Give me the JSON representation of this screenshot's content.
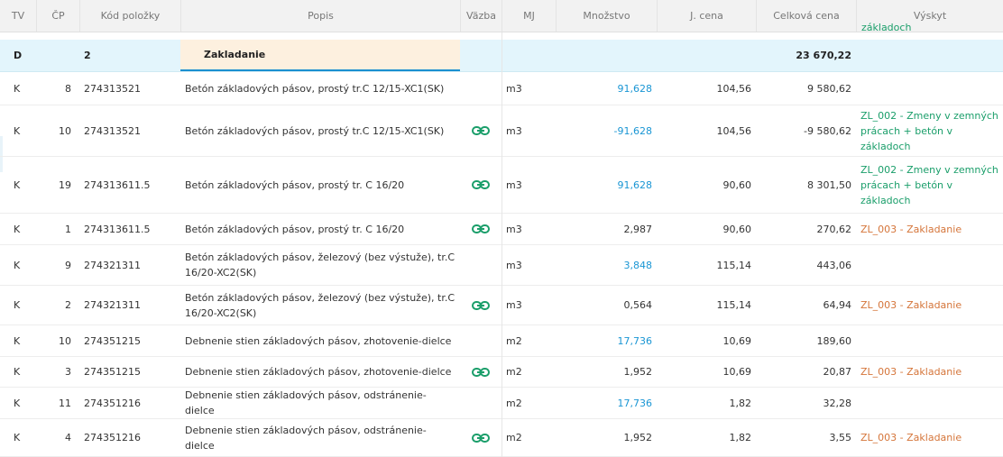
{
  "header": {
    "tv": "TV",
    "cp": "ČP",
    "kod": "Kód položky",
    "popis": "Popis",
    "vazba": "Väzba",
    "mj": "MJ",
    "mnozstvo": "Množstvo",
    "jcena": "J. cena",
    "celkova": "Celková cena",
    "vyskyt": "Výskyt",
    "spill": "základoch"
  },
  "group": {
    "tv": "D",
    "cp": "2",
    "popis": "Zakladanie",
    "celkova": "23 670,22"
  },
  "rows": [
    {
      "tv": "K",
      "cp": "8",
      "kod": "274313521",
      "popis": "Betón základových pásov, prostý tr.C 12/15-XC1(SK)",
      "link": false,
      "mj": "m3",
      "mnozstvo": "91,628",
      "mn_color": "blue",
      "jcena": "104,56",
      "celkova": "9 580,62",
      "vyskyt": "",
      "vy_color": ""
    },
    {
      "tv": "K",
      "cp": "10",
      "kod": "274313521",
      "popis": "Betón základových pásov, prostý tr.C 12/15-XC1(SK)",
      "link": true,
      "mj": "m3",
      "mnozstvo": "-91,628",
      "mn_color": "blue",
      "jcena": "104,56",
      "celkova": "-9 580,62",
      "vyskyt": "ZL_002 - Zmeny v zemných prácach + betón v základoch",
      "vy_color": "green"
    },
    {
      "tv": "K",
      "cp": "19",
      "kod": "274313611.5",
      "popis": "Betón základových pásov, prostý tr. C 16/20",
      "link": true,
      "mj": "m3",
      "mnozstvo": "91,628",
      "mn_color": "blue",
      "jcena": "90,60",
      "celkova": "8 301,50",
      "vyskyt": "ZL_002 - Zmeny v zemných prácach + betón v základoch",
      "vy_color": "green"
    },
    {
      "tv": "K",
      "cp": "1",
      "kod": "274313611.5",
      "popis": "Betón základových pásov, prostý tr. C 16/20",
      "link": true,
      "mj": "m3",
      "mnozstvo": "2,987",
      "mn_color": "",
      "jcena": "90,60",
      "celkova": "270,62",
      "vyskyt": "ZL_003 - Zakladanie",
      "vy_color": "orange"
    },
    {
      "tv": "K",
      "cp": "9",
      "kod": "274321311",
      "popis": "Betón základových pásov, železový (bez výstuže), tr.C 16/20-XC2(SK)",
      "link": false,
      "mj": "m3",
      "mnozstvo": "3,848",
      "mn_color": "blue",
      "jcena": "115,14",
      "celkova": "443,06",
      "vyskyt": "",
      "vy_color": ""
    },
    {
      "tv": "K",
      "cp": "2",
      "kod": "274321311",
      "popis": "Betón základových pásov, železový (bez výstuže), tr.C 16/20-XC2(SK)",
      "link": true,
      "mj": "m3",
      "mnozstvo": "0,564",
      "mn_color": "",
      "jcena": "115,14",
      "celkova": "64,94",
      "vyskyt": "ZL_003 - Zakladanie",
      "vy_color": "orange"
    },
    {
      "tv": "K",
      "cp": "10",
      "kod": "274351215",
      "popis": "Debnenie stien základových pásov, zhotovenie-dielce",
      "link": false,
      "mj": "m2",
      "mnozstvo": "17,736",
      "mn_color": "blue",
      "jcena": "10,69",
      "celkova": "189,60",
      "vyskyt": "",
      "vy_color": ""
    },
    {
      "tv": "K",
      "cp": "3",
      "kod": "274351215",
      "popis": "Debnenie stien základových pásov, zhotovenie-dielce",
      "link": true,
      "mj": "m2",
      "mnozstvo": "1,952",
      "mn_color": "",
      "jcena": "10,69",
      "celkova": "20,87",
      "vyskyt": "ZL_003 - Zakladanie",
      "vy_color": "orange"
    },
    {
      "tv": "K",
      "cp": "11",
      "kod": "274351216",
      "popis": "Debnenie stien základových pásov, odstránenie-dielce",
      "link": false,
      "mj": "m2",
      "mnozstvo": "17,736",
      "mn_color": "blue",
      "jcena": "1,82",
      "celkova": "32,28",
      "vyskyt": "",
      "vy_color": ""
    },
    {
      "tv": "K",
      "cp": "4",
      "kod": "274351216",
      "popis": "Debnenie stien základových pásov, odstránenie-dielce",
      "link": true,
      "mj": "m2",
      "mnozstvo": "1,952",
      "mn_color": "",
      "jcena": "1,82",
      "celkova": "3,55",
      "vyskyt": "ZL_003 - Zakladanie",
      "vy_color": "orange"
    }
  ],
  "colors": {
    "blue": "#1a96d4",
    "green": "#1a9e6a",
    "orange": "#d5753a",
    "group_bg": "#e3f5fc"
  }
}
